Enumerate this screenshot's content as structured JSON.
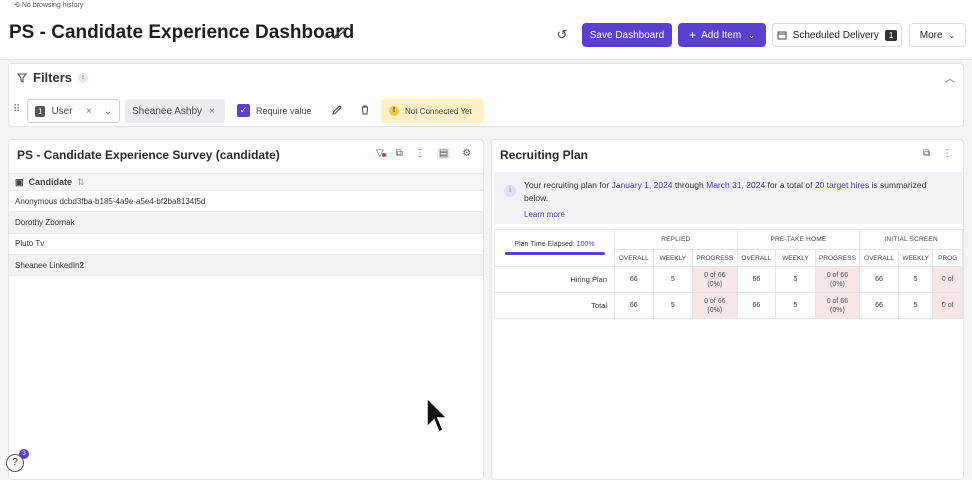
{
  "browser": {
    "notice": "No browsing history"
  },
  "header": {
    "title": "PS - Candidate Experience Dashboard",
    "save_label": "Save Dashboard",
    "add_label": "Add Item",
    "scheduled_label": "Scheduled Delivery",
    "scheduled_count": "1",
    "more_label": "More"
  },
  "filters": {
    "title": "Filters",
    "field_index": "1",
    "field_label": "User",
    "value_chip": "Sheanee Ashby",
    "require_label": "Require value",
    "require_checked": true,
    "warning": "Not Connected Yet"
  },
  "left_panel": {
    "title": "PS - Candidate Experience Survey (candidate)",
    "column": "Candidate",
    "rows": [
      "Anonymous dcbd3fba-b185-4a9e-a5e4-bf2ba8134f5d",
      "Dorothy Zbornak",
      "Pluto Tv",
      "Sheanee LinkedIn2"
    ]
  },
  "right_panel": {
    "title": "Recruiting Plan",
    "info_prefix": "Your recruiting plan for ",
    "start_date": "January 1, 2024",
    "through": " through ",
    "end_date": "March 31, 2024",
    "for_total": " for a total of ",
    "target": "20 target hires",
    "info_suffix": " is summarized below.",
    "learn_more": "Learn more",
    "elapsed_label": "Plan Time Elapsed:",
    "elapsed_value": "100%",
    "elapsed_fraction": 1.0,
    "groups": [
      "REPLIED",
      "PRE-TAKE HOME",
      "INITIAL SCREEN"
    ],
    "subcols": [
      "OVERALL",
      "WEEKLY",
      "PROGRESS"
    ],
    "progress_partial": "PROG",
    "rows": [
      {
        "label": "Hiring Plan",
        "overall": "66",
        "weekly": "5",
        "progress": "0 of 66",
        "pct": "(0%)"
      },
      {
        "label": "Total",
        "overall": "66",
        "weekly": "5",
        "progress": "0 of 66",
        "pct": "(0%)"
      }
    ],
    "partial_cell": "0 of"
  },
  "help": {
    "count": "3"
  }
}
